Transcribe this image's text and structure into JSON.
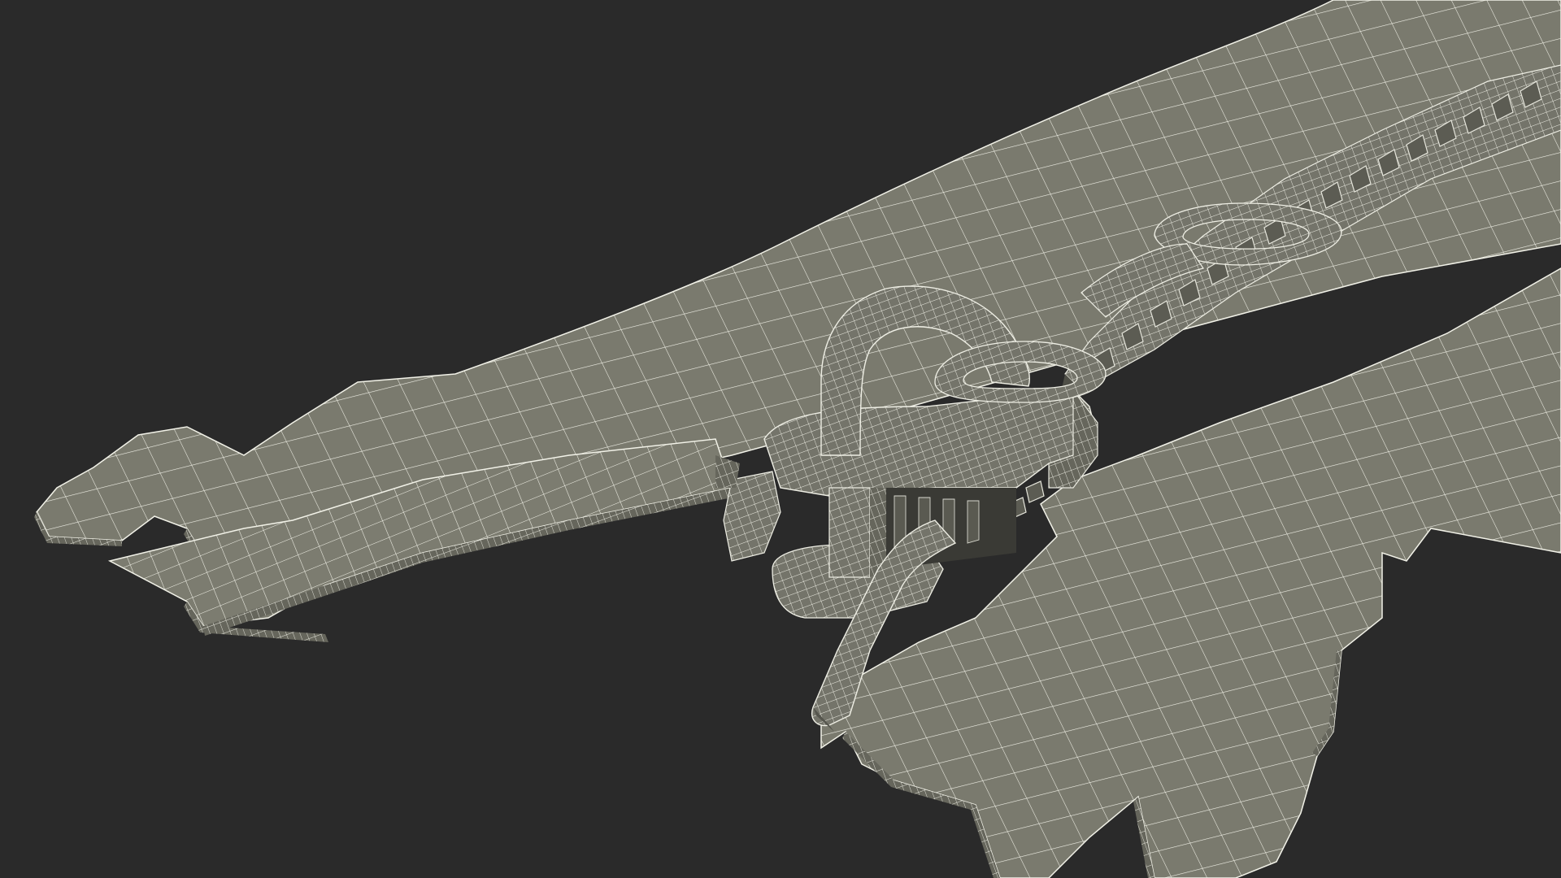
{
  "scene": {
    "subject": "zipper-wireframe-render",
    "colors": {
      "background": "#2a2a2a",
      "surface": "#7d7d70",
      "surface_dark": "#5f5f55",
      "surface_shadow": "#4a4a43",
      "wire": "#f4f4ea"
    }
  }
}
